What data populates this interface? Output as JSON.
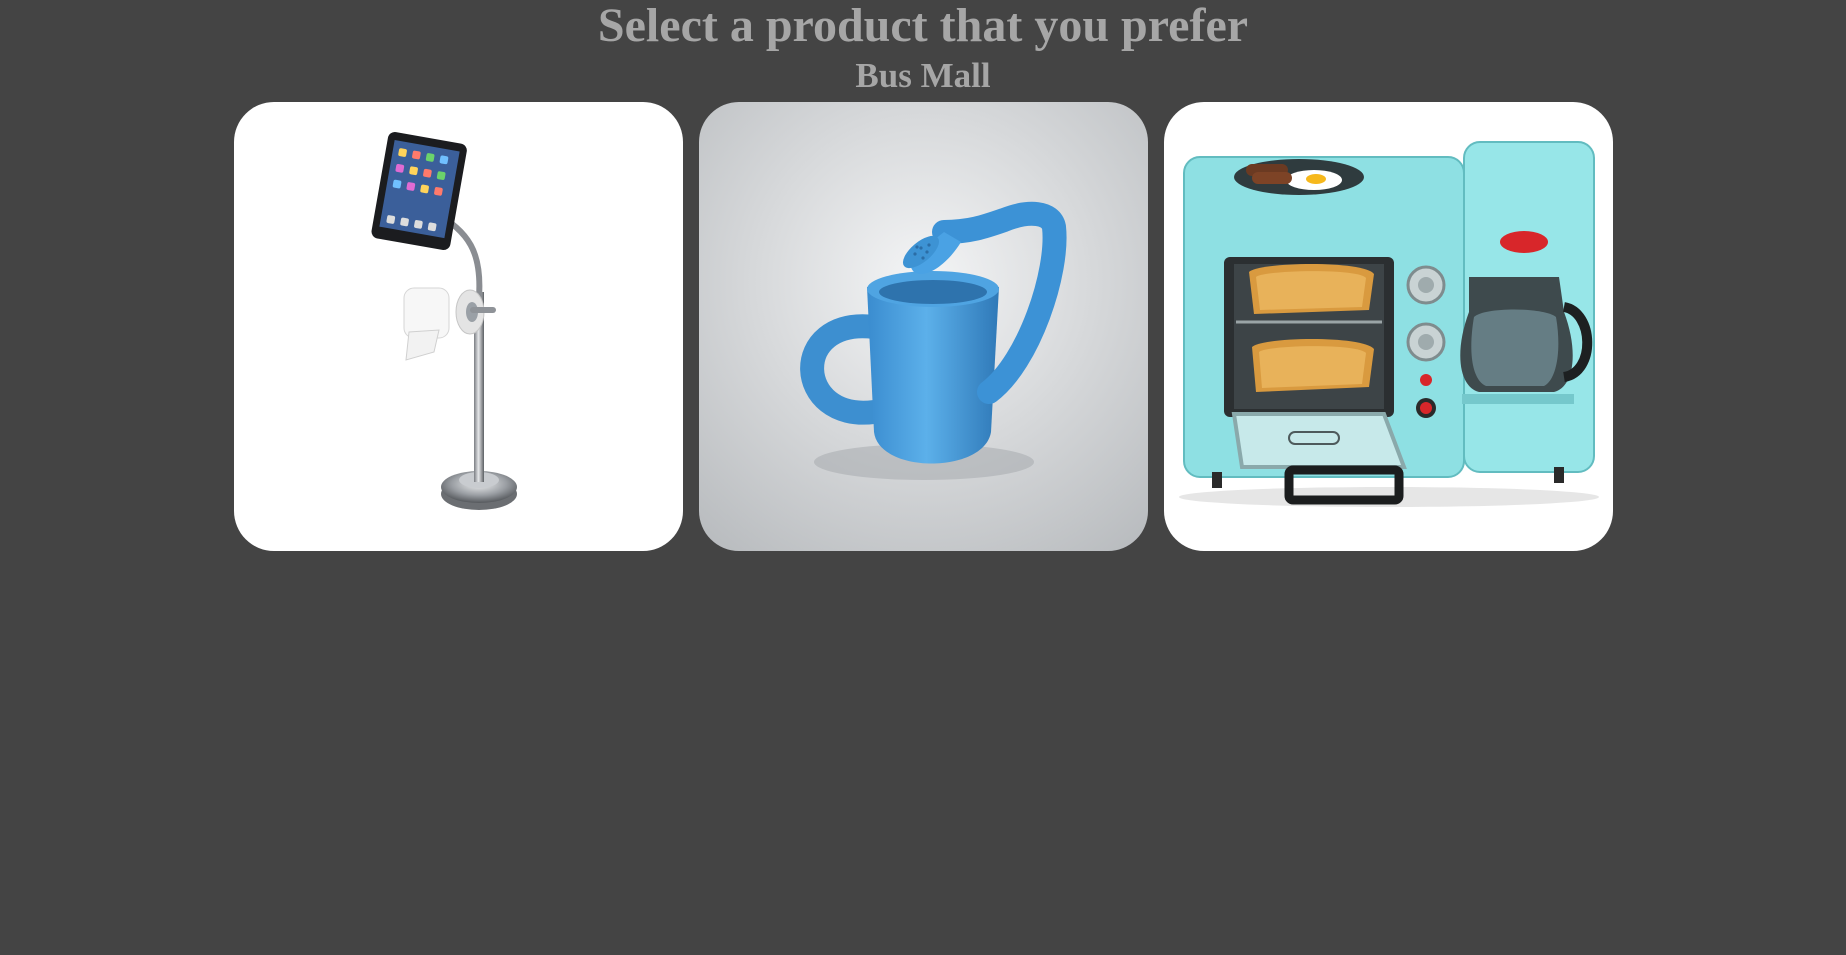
{
  "page": {
    "title": "Select a product that you prefer",
    "subtitle": "Bus Mall"
  },
  "colors": {
    "background": "#444444",
    "heading": "#a6a6a6",
    "card": "#ffffff"
  },
  "products": [
    {
      "icon": "pet-sweet-toilet-ipad-stand-icon"
    },
    {
      "icon": "watering-can-mug-icon"
    },
    {
      "icon": "breakfast-station-toaster-oven-icon"
    }
  ]
}
